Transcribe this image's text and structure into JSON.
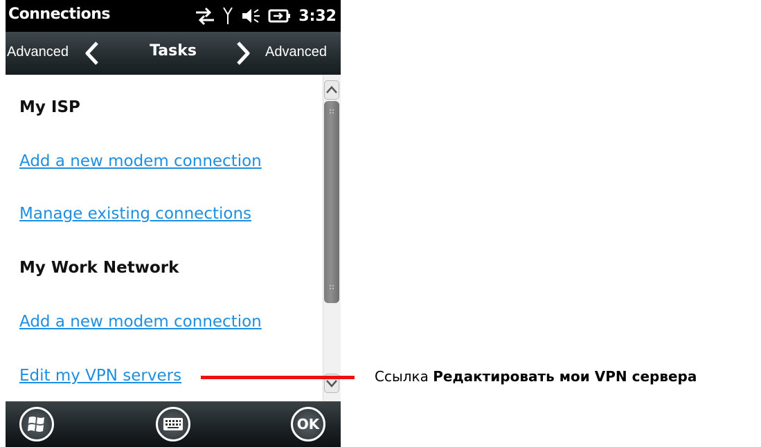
{
  "status_bar": {
    "title": "Connections",
    "time": "3:32",
    "icons": [
      "data-transfer-icon",
      "signal-antenna-icon",
      "speaker-icon",
      "battery-charging-icon"
    ]
  },
  "nav_bar": {
    "left_label": "Advanced",
    "title": "Tasks",
    "right_label": "Advanced"
  },
  "content": {
    "items": [
      {
        "type": "heading",
        "text": "My ISP"
      },
      {
        "type": "link",
        "text": "Add a new modem connection"
      },
      {
        "type": "link",
        "text": "Manage existing connections"
      },
      {
        "type": "heading",
        "text": "My Work Network"
      },
      {
        "type": "link",
        "text": "Add a new modem connection"
      },
      {
        "type": "link",
        "text": "Edit my VPN servers"
      }
    ]
  },
  "bottom_bar": {
    "ok_label": "OK",
    "buttons": [
      "windows-start-icon",
      "keyboard-icon",
      "ok-button"
    ]
  },
  "annotation": {
    "prefix": "Ссылка",
    "bold": "Редактировать мои VPN сервера"
  },
  "colors": {
    "link": "#1e8fe0",
    "callout_line": "#ee1111",
    "status_bar_bg": "#000000"
  }
}
